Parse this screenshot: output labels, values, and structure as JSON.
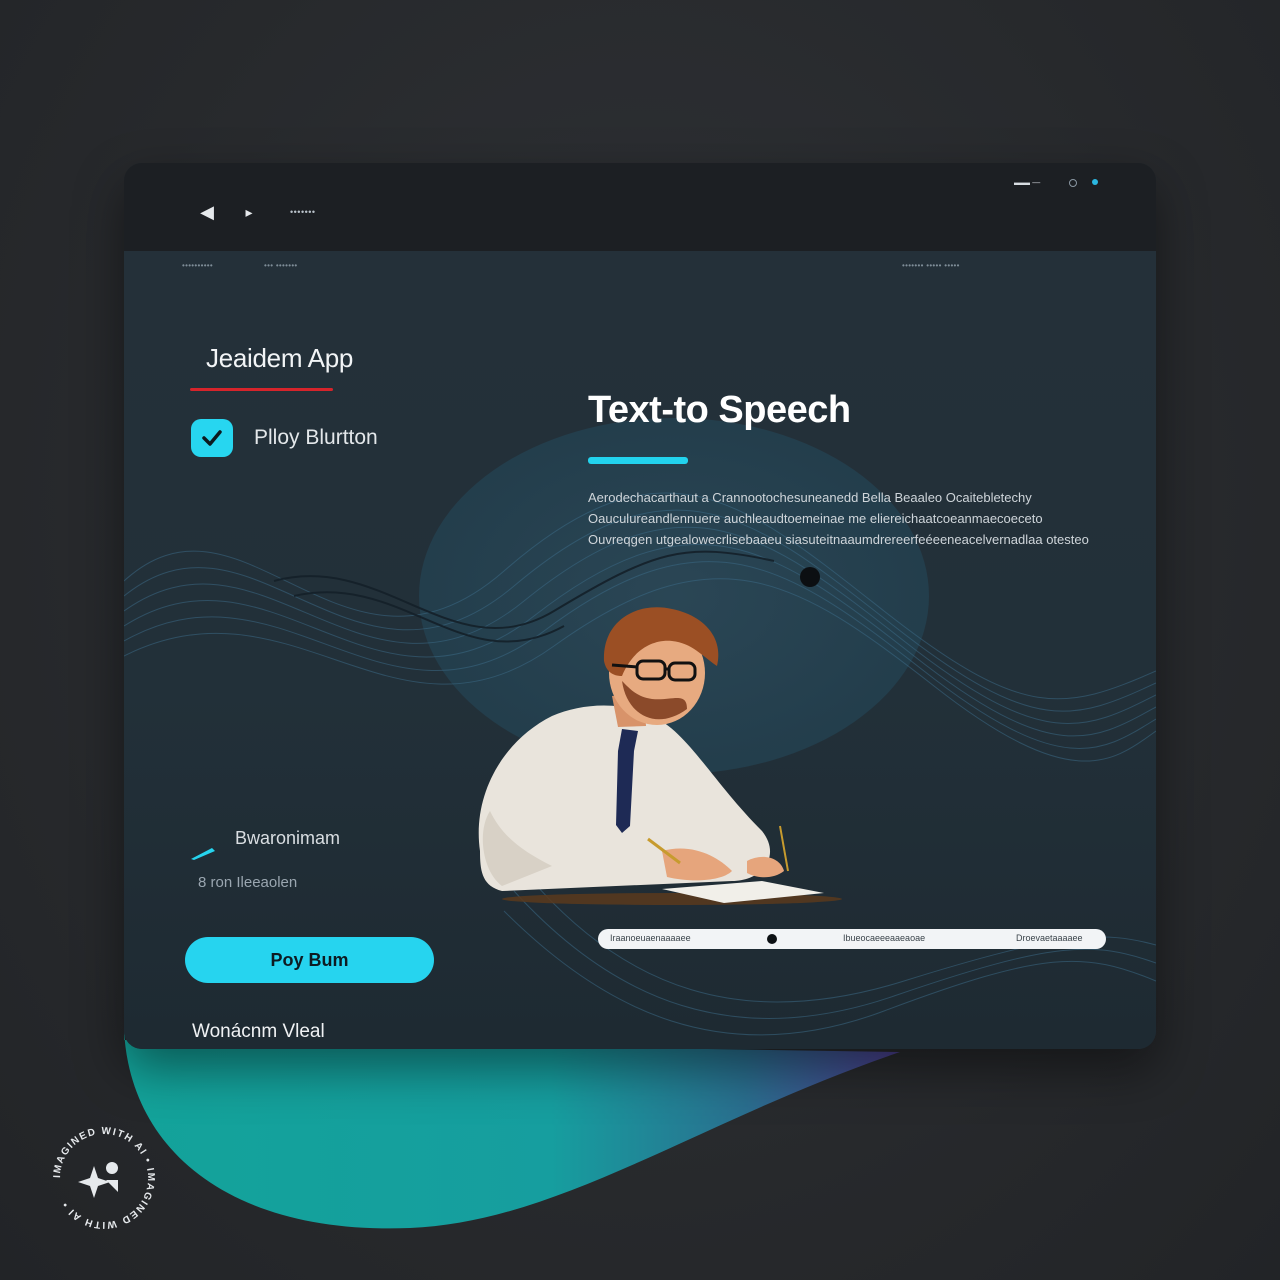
{
  "window": {
    "titlebar_text": "•••••••",
    "status_right": "▬▬ —"
  },
  "subnav": {
    "left_1": "••••••••••",
    "left_2": "••• •••••••",
    "right_1": "••••••• ••••• •••••"
  },
  "left_panel": {
    "app_title": "Jeaidem App",
    "check_label": "Plloy  Blurtton",
    "label_a": "Bwaronimam",
    "label_b": "8  ron   Ileeaolen",
    "primary_button": "Poy Bum",
    "label_c": "Wonácnm Vleal"
  },
  "main": {
    "heading": "Text-to Speech",
    "paragraph": "Aerodechacarthaut a Crannootochesuneanedd Bella Beaaleo Ocaitebletechy Oauculureandlennuere auchleaudtoemeinae  me eliereichaatcoeanmaecoeceto Ouvreqgen utgealowecrlisebaaeu siasuteitnaaumdrereerfeéeeneacelvernadlaa otesteo"
  },
  "progress": {
    "left_text": "Iraanoeuaenaaaaee",
    "mid_text": "Ibueocaeeeaaeaoae",
    "right_text": "Droevaetaaaaee",
    "position_fraction": 0.34
  },
  "badge": {
    "text": "IMAGINED WITH AI • IMAGINED WITH AI •"
  },
  "colors": {
    "accent": "#26d4ef",
    "underline_red": "#d6242b",
    "window_bg": "#1f2a33",
    "titlebar_bg": "#1c1f23"
  }
}
